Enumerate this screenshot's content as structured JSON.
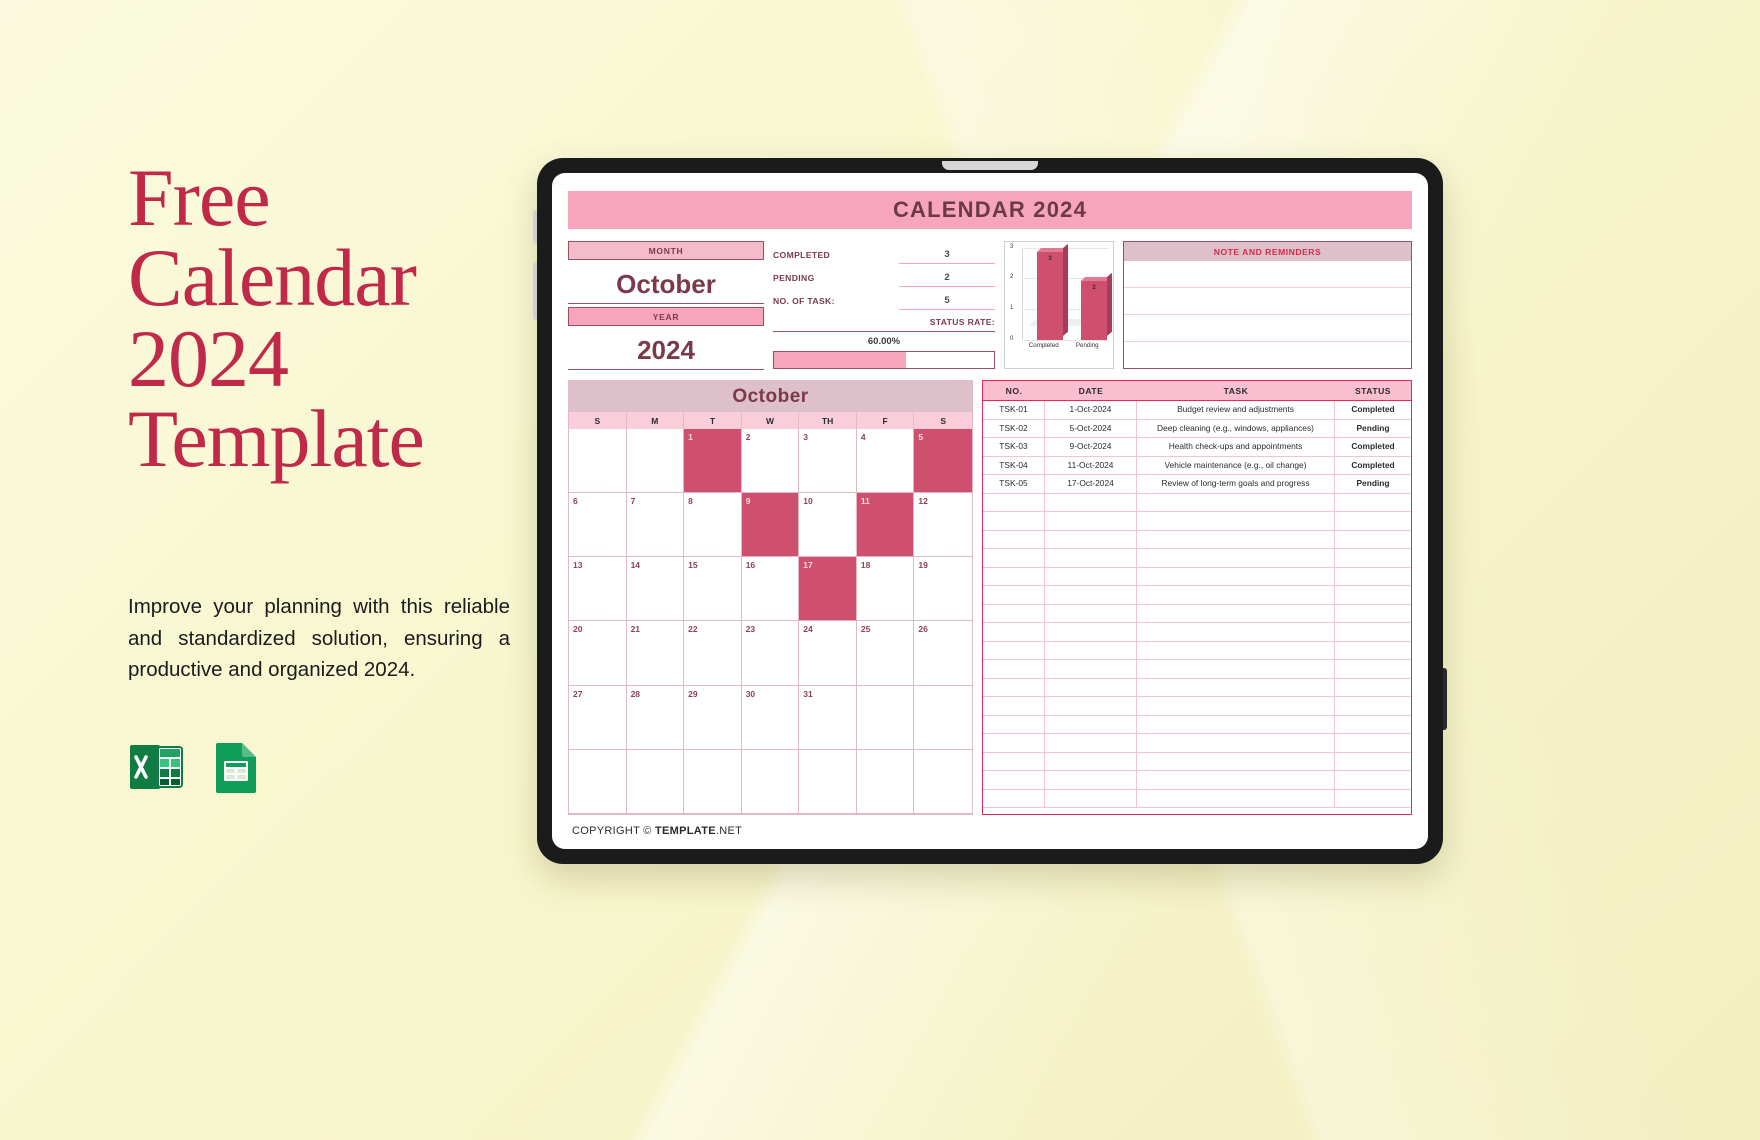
{
  "promo": {
    "title_lines": [
      "Free",
      "Calendar",
      "2024",
      "Template"
    ],
    "description": "Improve your planning with this reliable and standardized solution, ensuring a productive and organized 2024.",
    "icons": [
      {
        "name": "excel-icon",
        "label": "X"
      },
      {
        "name": "google-sheets-icon",
        "label": ""
      }
    ],
    "accent_color": "#c02a48"
  },
  "sheet": {
    "title": "CALENDAR 2024",
    "month_label": "MONTH",
    "month_value": "October",
    "year_label": "YEAR",
    "year_value": "2024",
    "stats": [
      {
        "label": "COMPLETED",
        "value": "3"
      },
      {
        "label": "PENDING",
        "value": "2"
      },
      {
        "label": "NO. OF TASK:",
        "value": "5"
      }
    ],
    "status_rate_label": "STATUS RATE:",
    "status_rate_value": "60.00%",
    "status_rate_pct": 60,
    "notes_title": "NOTE AND REMINDERS",
    "footer_prefix": "COPYRIGHT © ",
    "footer_brand": "TEMPLATE",
    "footer_suffix": ".NET"
  },
  "chart_data": {
    "type": "bar",
    "categories": [
      "Completed",
      "Pending"
    ],
    "values": [
      3,
      2
    ],
    "title": "",
    "xlabel": "",
    "ylabel": "",
    "ylim": [
      0,
      3
    ],
    "yticks": [
      "3",
      "2",
      "1",
      "0"
    ],
    "grid": true,
    "legend": "none",
    "bar_color": "#cf4f6e"
  },
  "calendar": {
    "month": "October",
    "weekdays": [
      "S",
      "M",
      "T",
      "W",
      "TH",
      "F",
      "S"
    ],
    "leading_blanks": 2,
    "days": [
      1,
      2,
      3,
      4,
      5,
      6,
      7,
      8,
      9,
      10,
      11,
      12,
      13,
      14,
      15,
      16,
      17,
      18,
      19,
      20,
      21,
      22,
      23,
      24,
      25,
      26,
      27,
      28,
      29,
      30,
      31
    ],
    "highlighted": [
      1,
      5,
      9,
      11,
      17
    ]
  },
  "tasks": {
    "columns": [
      "NO.",
      "DATE",
      "TASK",
      "STATUS"
    ],
    "rows": [
      {
        "no": "TSK-01",
        "date": "1-Oct-2024",
        "task": "Budget review and adjustments",
        "status": "Completed"
      },
      {
        "no": "TSK-02",
        "date": "5-Oct-2024",
        "task": "Deep cleaning (e.g., windows, appliances)",
        "status": "Pending"
      },
      {
        "no": "TSK-03",
        "date": "9-Oct-2024",
        "task": "Health check-ups and appointments",
        "status": "Completed"
      },
      {
        "no": "TSK-04",
        "date": "11-Oct-2024",
        "task": "Vehicle maintenance (e.g., oil change)",
        "status": "Completed"
      },
      {
        "no": "TSK-05",
        "date": "17-Oct-2024",
        "task": "Review of long-term goals and progress",
        "status": "Pending"
      }
    ],
    "empty_rows": 17
  }
}
